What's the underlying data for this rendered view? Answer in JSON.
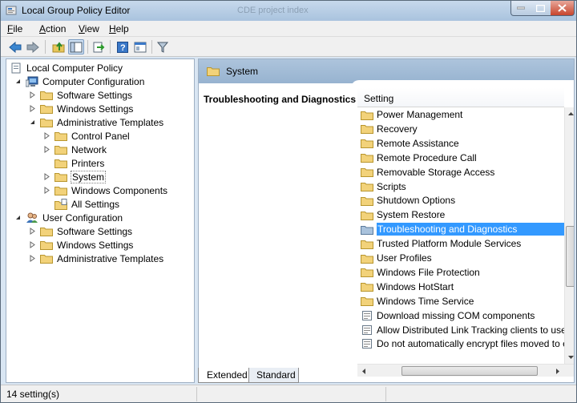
{
  "window": {
    "title": "Local Group Policy Editor",
    "ghost_title": "CDE project index"
  },
  "menu": {
    "items": [
      {
        "label": "File",
        "key": "F",
        "rest": "ile"
      },
      {
        "label": "Action",
        "key": "A",
        "rest": "ction"
      },
      {
        "label": "View",
        "key": "V",
        "rest": "iew"
      },
      {
        "label": "Help",
        "key": "H",
        "rest": "elp"
      }
    ]
  },
  "toolbar": {
    "buttons": [
      "back-icon",
      "forward-icon",
      "up-folder-icon",
      "show-hide-tree-icon",
      "export-list-icon",
      "help-icon",
      "properties-icon",
      "filter-icon"
    ]
  },
  "tree": {
    "root": "Local Computer Policy",
    "computer_config": "Computer Configuration",
    "cc_software": "Software Settings",
    "cc_windows": "Windows Settings",
    "cc_admin": "Administrative Templates",
    "cc_control_panel": "Control Panel",
    "cc_network": "Network",
    "cc_printers": "Printers",
    "cc_system": "System",
    "cc_windows_components": "Windows Components",
    "cc_all_settings": "All Settings",
    "user_config": "User Configuration",
    "uc_software": "Software Settings",
    "uc_windows": "Windows Settings",
    "uc_admin": "Administrative Templates"
  },
  "right": {
    "header_title": "System",
    "description_title": "Troubleshooting and Diagnostics",
    "column_setting": "Setting",
    "rows": [
      {
        "label": "Power Management",
        "icon": "folder"
      },
      {
        "label": "Recovery",
        "icon": "folder"
      },
      {
        "label": "Remote Assistance",
        "icon": "folder"
      },
      {
        "label": "Remote Procedure Call",
        "icon": "folder"
      },
      {
        "label": "Removable Storage Access",
        "icon": "folder"
      },
      {
        "label": "Scripts",
        "icon": "folder"
      },
      {
        "label": "Shutdown Options",
        "icon": "folder"
      },
      {
        "label": "System Restore",
        "icon": "folder"
      },
      {
        "label": "Troubleshooting and Diagnostics",
        "icon": "folder",
        "selected": true
      },
      {
        "label": "Trusted Platform Module Services",
        "icon": "folder"
      },
      {
        "label": "User Profiles",
        "icon": "folder"
      },
      {
        "label": "Windows File Protection",
        "icon": "folder"
      },
      {
        "label": "Windows HotStart",
        "icon": "folder"
      },
      {
        "label": "Windows Time Service",
        "icon": "folder"
      },
      {
        "label": "Download missing COM components",
        "icon": "policy"
      },
      {
        "label": "Allow Distributed Link Tracking clients to use d",
        "icon": "policy"
      },
      {
        "label": "Do not automatically encrypt files moved to en",
        "icon": "policy"
      }
    ]
  },
  "tabs": {
    "extended": "Extended",
    "standard": "Standard"
  },
  "status": {
    "text": "14 setting(s)"
  }
}
